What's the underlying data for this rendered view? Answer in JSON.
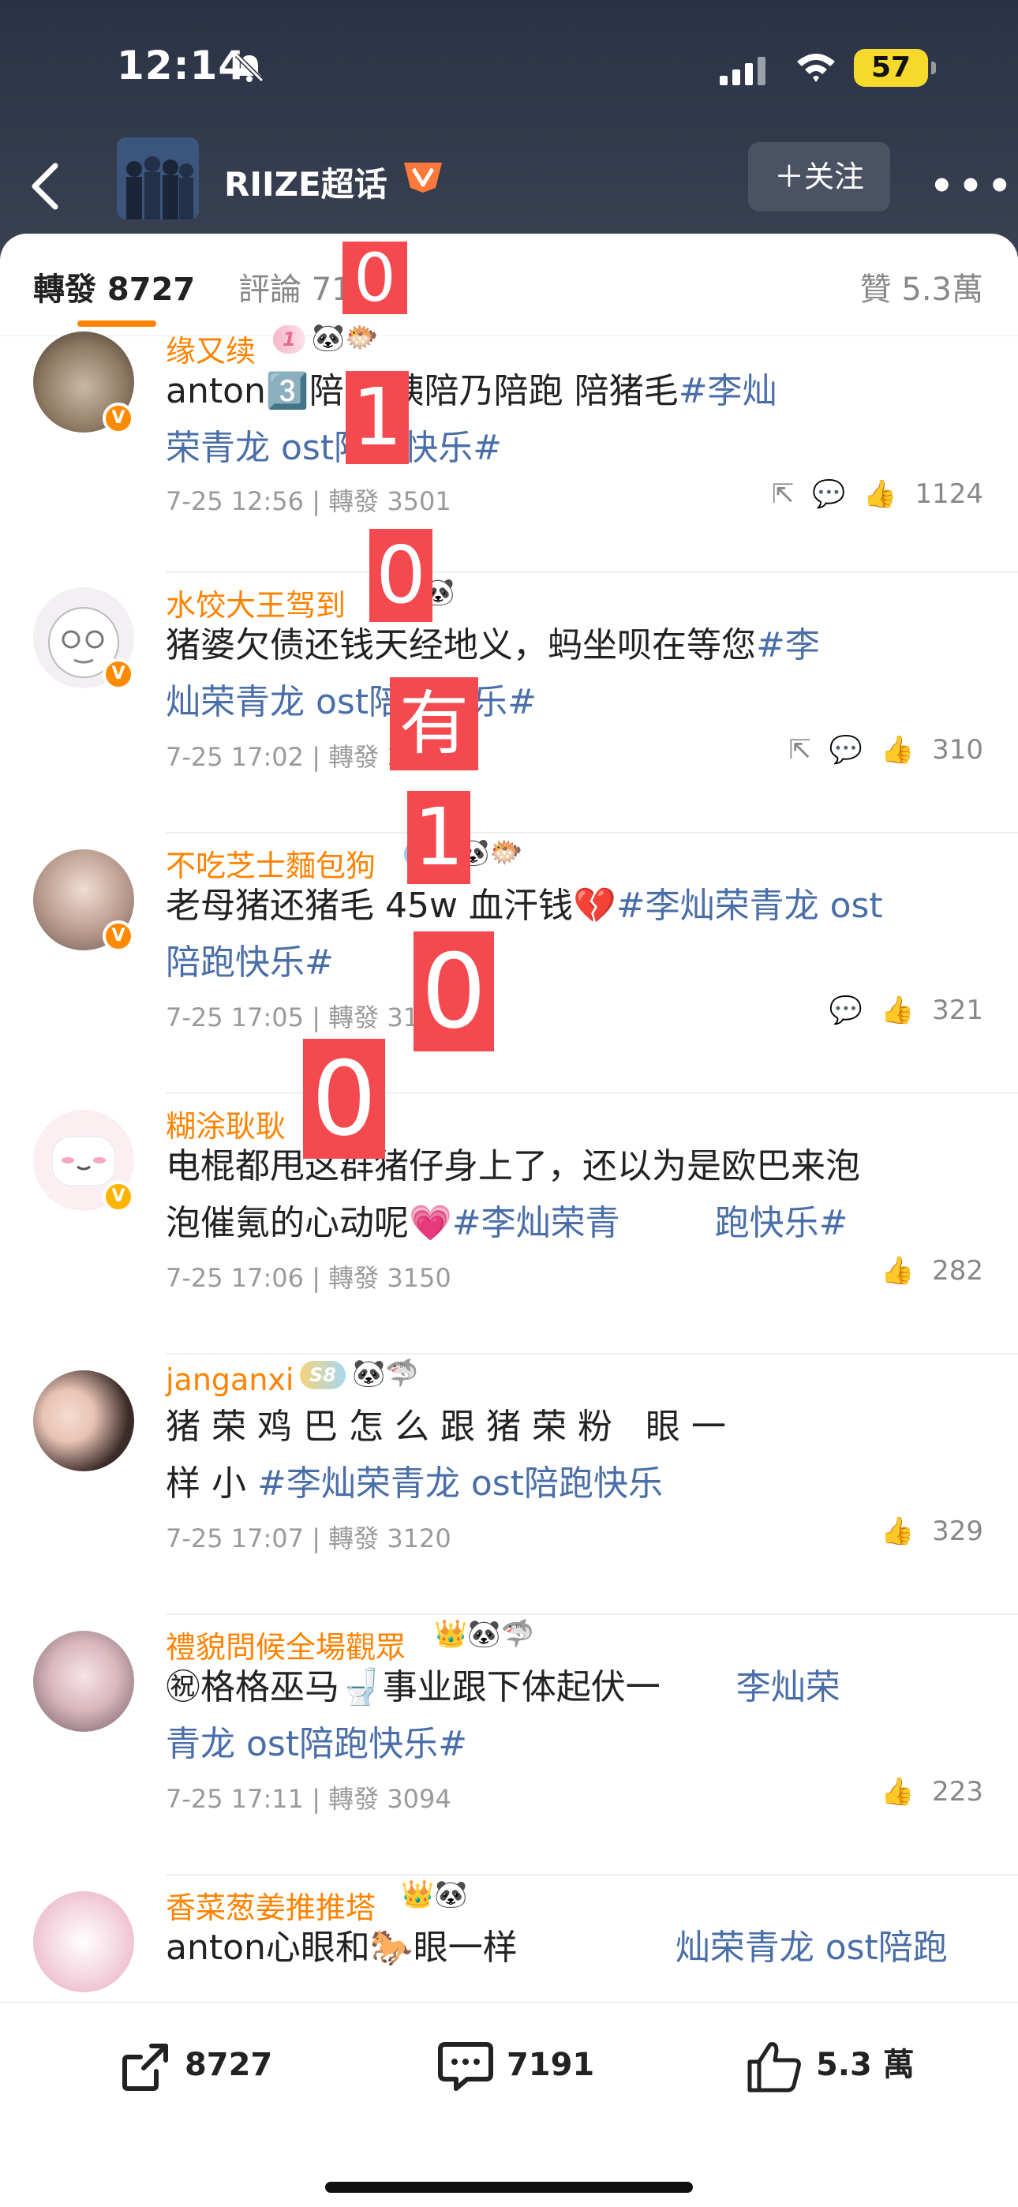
{
  "status": {
    "time": "12:14",
    "battery": "57"
  },
  "nav": {
    "title": "RIIZE超话",
    "follow": "＋关注"
  },
  "tabs": {
    "repost": "轉發 8727",
    "comment": "評論 7191",
    "like": "贊 5.3萬"
  },
  "posts": [
    {
      "user": "缘又续",
      "pre": "anton3️⃣陪 陪姨陪乃陪跑",
      "pre2": "陪猪毛",
      "tag1": "#李灿",
      "tag2": "荣青龙 ost陪跑快乐#",
      "meta": "7-25 12:56 | 轉發 3501",
      "likes": "1124"
    },
    {
      "user": "水饺大王驾到",
      "pre": "猪婆欠债还钱天经地义，",
      "pre2": "坐呗在等您",
      "tag1": "#李",
      "tag2": "灿荣青龙 ost陪跑快乐#",
      "meta": "7-25 17:02 | 轉發 3213",
      "likes": "310"
    },
    {
      "user": "不吃芝士麵包狗",
      "pre": "老母猪还猪毛 45w 血汗钱💔",
      "tag1": "#李灿荣青龙 ost",
      "tag2": "陪跑快乐#",
      "meta": "7-25 17:05 | 轉發 3180",
      "likes": "321"
    },
    {
      "user": "糊涂耿耿",
      "pre": "电棍都甩这群猪仔身上了，还以为是欧巴来泡",
      "pre2": "泡催氪的心动呢💗",
      "tag1": "#李灿荣青",
      "tag2": "跑快乐#",
      "meta": "7-25 17:06 | 轉發 3150",
      "likes": "282"
    },
    {
      "user": "janganxi",
      "pre": "猪荣鸡巴怎么跟猪荣粉",
      "pre2": "眼一",
      "tag1": "样小",
      "tag2": "#李灿荣青龙 ost陪跑快乐",
      "meta": "7-25 17:07 | 轉發 3120",
      "likes": "329"
    },
    {
      "user": "禮貌問候全場觀眾",
      "pre": "㊗格格巫马🚽事业跟下体起伏一",
      "tag1": "李灿荣",
      "tag2": "青龙 ost陪跑快乐#",
      "meta": "7-25 17:11 | 轉發 3094",
      "likes": "223"
    },
    {
      "user": "香菜葱姜推推塔",
      "pre": "anton心眼和🐎眼一样",
      "tag1": "灿荣青龙 ost陪跑"
    }
  ],
  "overlays": [
    "0",
    "1",
    "0",
    "有",
    "1",
    "0",
    "0"
  ],
  "bottom": {
    "repost": "8727",
    "comment": "7191",
    "like": "5.3 萬"
  }
}
